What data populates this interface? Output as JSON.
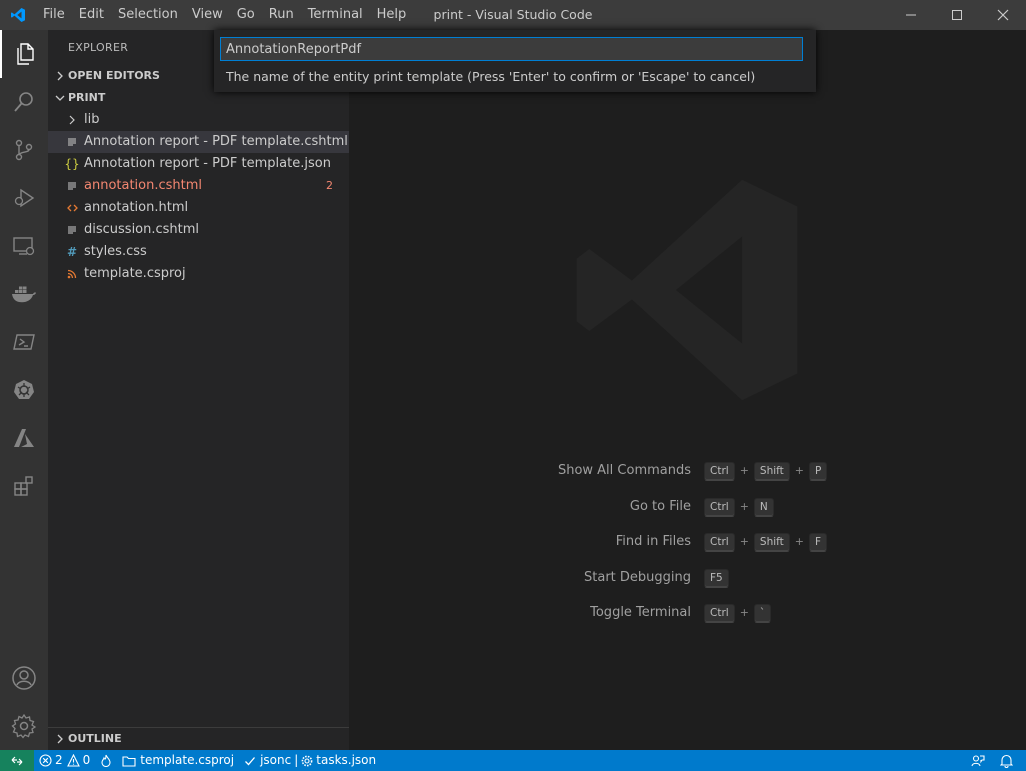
{
  "window": {
    "title": "print - Visual Studio Code"
  },
  "menu": [
    "File",
    "Edit",
    "Selection",
    "View",
    "Go",
    "Run",
    "Terminal",
    "Help"
  ],
  "activity_bar": {
    "top_icons": [
      "explorer-icon",
      "search-icon",
      "source-control-icon",
      "run-debug-icon",
      "remote-explorer-icon",
      "docker-icon",
      "powershell-icon",
      "kubernetes-icon",
      "azure-icon",
      "extensions-icon"
    ],
    "bottom_icons": [
      "accounts-icon",
      "settings-gear-icon"
    ]
  },
  "sidebar": {
    "title": "EXPLORER",
    "open_editors": "OPEN EDITORS",
    "folder": "PRINT",
    "files": [
      {
        "name": "lib",
        "icon": "chevron-right-icon",
        "color": "#cccccc"
      },
      {
        "name": "Annotation report - PDF template.cshtml",
        "icon": "lines-icon",
        "color": "#cccccc",
        "selected": true
      },
      {
        "name": "Annotation report - PDF template.json",
        "icon": "braces-icon",
        "color": "#cccccc"
      },
      {
        "name": "annotation.cshtml",
        "icon": "lines-icon",
        "color": "#f48771",
        "badge": "2"
      },
      {
        "name": "annotation.html",
        "icon": "html-icon",
        "color": "#cccccc"
      },
      {
        "name": "discussion.cshtml",
        "icon": "lines-icon",
        "color": "#cccccc"
      },
      {
        "name": "styles.css",
        "icon": "hash-icon",
        "color": "#cccccc"
      },
      {
        "name": "template.csproj",
        "icon": "rss-icon",
        "color": "#cccccc"
      }
    ],
    "outline": "OUTLINE"
  },
  "quick_input": {
    "value": "AnnotationReportPdf",
    "message": "The name of the entity print template (Press 'Enter' to confirm or 'Escape' to cancel)"
  },
  "shortcuts": [
    {
      "label": "Show All Commands",
      "keys": [
        "Ctrl",
        "Shift",
        "P"
      ]
    },
    {
      "label": "Go to File",
      "keys": [
        "Ctrl",
        "N"
      ]
    },
    {
      "label": "Find in Files",
      "keys": [
        "Ctrl",
        "Shift",
        "F"
      ]
    },
    {
      "label": "Start Debugging",
      "keys": [
        "F5"
      ]
    },
    {
      "label": "Toggle Terminal",
      "keys": [
        "Ctrl",
        "`"
      ]
    }
  ],
  "statusbar": {
    "errors": "2",
    "warnings": "0",
    "project": "template.csproj",
    "language": "jsonc",
    "separator": "|",
    "tasks_file": "tasks.json"
  },
  "colors": {
    "accent": "#007acc",
    "remote": "#16825d",
    "error_text": "#f48771"
  }
}
